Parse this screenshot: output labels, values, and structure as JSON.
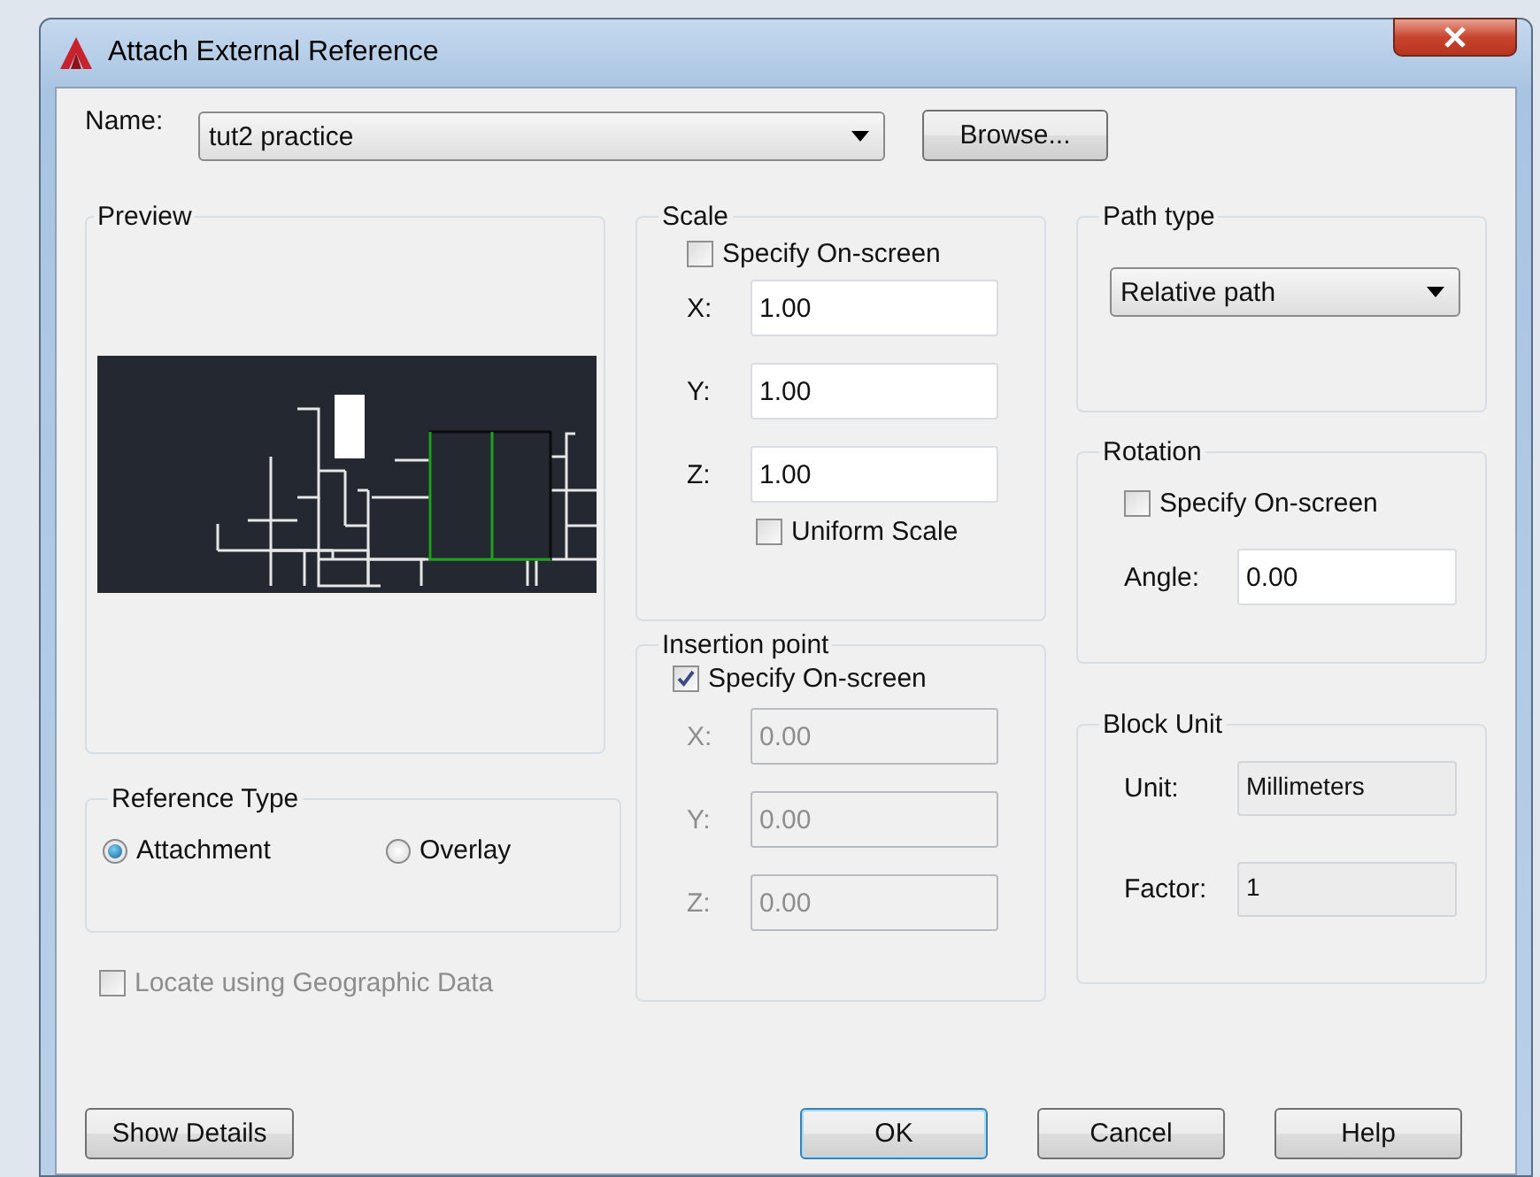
{
  "window": {
    "title": "Attach External Reference"
  },
  "name_field": {
    "label": "Name:",
    "value": "tut2 practice"
  },
  "browse_button": "Browse...",
  "preview": {
    "title": "Preview"
  },
  "reference_type": {
    "title": "Reference Type",
    "options": [
      {
        "label": "Attachment",
        "selected": true
      },
      {
        "label": "Overlay",
        "selected": false
      }
    ]
  },
  "locate_geographic": {
    "label": "Locate using Geographic Data",
    "checked": false,
    "disabled": true
  },
  "scale": {
    "title": "Scale",
    "specify_on_screen": {
      "label": "Specify On-screen",
      "checked": false
    },
    "fields": [
      {
        "label": "X:",
        "value": "1.00",
        "disabled": false
      },
      {
        "label": "Y:",
        "value": "1.00",
        "disabled": false
      },
      {
        "label": "Z:",
        "value": "1.00",
        "disabled": false
      }
    ],
    "uniform_scale": {
      "label": "Uniform Scale",
      "checked": false
    }
  },
  "insertion_point": {
    "title": "Insertion point",
    "specify_on_screen": {
      "label": "Specify On-screen",
      "checked": true
    },
    "fields": [
      {
        "label": "X:",
        "value": "0.00",
        "disabled": true
      },
      {
        "label": "Y:",
        "value": "0.00",
        "disabled": true
      },
      {
        "label": "Z:",
        "value": "0.00",
        "disabled": true
      }
    ]
  },
  "path_type": {
    "title": "Path type",
    "value": "Relative path"
  },
  "rotation": {
    "title": "Rotation",
    "specify_on_screen": {
      "label": "Specify On-screen",
      "checked": false
    },
    "angle": {
      "label": "Angle:",
      "value": "0.00"
    }
  },
  "block_unit": {
    "title": "Block Unit",
    "unit": {
      "label": "Unit:",
      "value": "Millimeters"
    },
    "factor": {
      "label": "Factor:",
      "value": "1"
    }
  },
  "show_details_button": "Show Details",
  "buttons": [
    {
      "label": "OK",
      "default": true
    },
    {
      "label": "Cancel",
      "default": false
    },
    {
      "label": "Help",
      "default": false
    }
  ]
}
